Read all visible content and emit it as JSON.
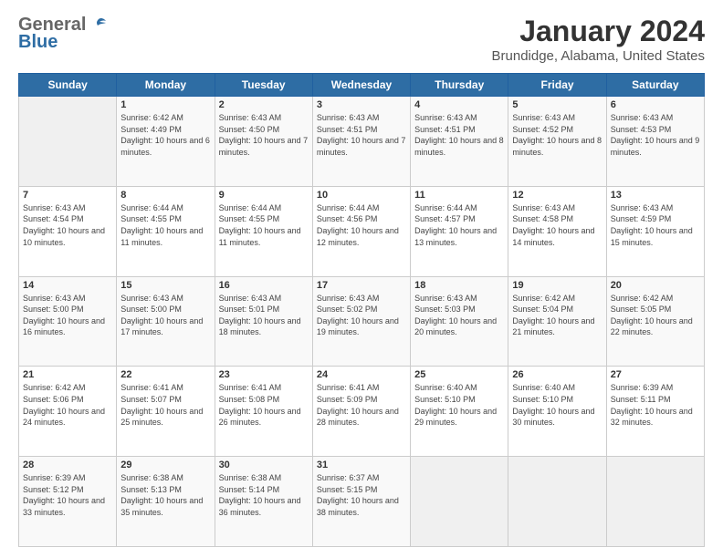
{
  "header": {
    "logo_general": "General",
    "logo_blue": "Blue",
    "title": "January 2024",
    "subtitle": "Brundidge, Alabama, United States"
  },
  "calendar": {
    "days_of_week": [
      "Sunday",
      "Monday",
      "Tuesday",
      "Wednesday",
      "Thursday",
      "Friday",
      "Saturday"
    ],
    "weeks": [
      [
        {
          "day": "",
          "sunrise": "",
          "sunset": "",
          "daylight": "",
          "empty": true
        },
        {
          "day": "1",
          "sunrise": "Sunrise: 6:42 AM",
          "sunset": "Sunset: 4:49 PM",
          "daylight": "Daylight: 10 hours and 6 minutes."
        },
        {
          "day": "2",
          "sunrise": "Sunrise: 6:43 AM",
          "sunset": "Sunset: 4:50 PM",
          "daylight": "Daylight: 10 hours and 7 minutes."
        },
        {
          "day": "3",
          "sunrise": "Sunrise: 6:43 AM",
          "sunset": "Sunset: 4:51 PM",
          "daylight": "Daylight: 10 hours and 7 minutes."
        },
        {
          "day": "4",
          "sunrise": "Sunrise: 6:43 AM",
          "sunset": "Sunset: 4:51 PM",
          "daylight": "Daylight: 10 hours and 8 minutes."
        },
        {
          "day": "5",
          "sunrise": "Sunrise: 6:43 AM",
          "sunset": "Sunset: 4:52 PM",
          "daylight": "Daylight: 10 hours and 8 minutes."
        },
        {
          "day": "6",
          "sunrise": "Sunrise: 6:43 AM",
          "sunset": "Sunset: 4:53 PM",
          "daylight": "Daylight: 10 hours and 9 minutes."
        }
      ],
      [
        {
          "day": "7",
          "sunrise": "Sunrise: 6:43 AM",
          "sunset": "Sunset: 4:54 PM",
          "daylight": "Daylight: 10 hours and 10 minutes."
        },
        {
          "day": "8",
          "sunrise": "Sunrise: 6:44 AM",
          "sunset": "Sunset: 4:55 PM",
          "daylight": "Daylight: 10 hours and 11 minutes."
        },
        {
          "day": "9",
          "sunrise": "Sunrise: 6:44 AM",
          "sunset": "Sunset: 4:55 PM",
          "daylight": "Daylight: 10 hours and 11 minutes."
        },
        {
          "day": "10",
          "sunrise": "Sunrise: 6:44 AM",
          "sunset": "Sunset: 4:56 PM",
          "daylight": "Daylight: 10 hours and 12 minutes."
        },
        {
          "day": "11",
          "sunrise": "Sunrise: 6:44 AM",
          "sunset": "Sunset: 4:57 PM",
          "daylight": "Daylight: 10 hours and 13 minutes."
        },
        {
          "day": "12",
          "sunrise": "Sunrise: 6:43 AM",
          "sunset": "Sunset: 4:58 PM",
          "daylight": "Daylight: 10 hours and 14 minutes."
        },
        {
          "day": "13",
          "sunrise": "Sunrise: 6:43 AM",
          "sunset": "Sunset: 4:59 PM",
          "daylight": "Daylight: 10 hours and 15 minutes."
        }
      ],
      [
        {
          "day": "14",
          "sunrise": "Sunrise: 6:43 AM",
          "sunset": "Sunset: 5:00 PM",
          "daylight": "Daylight: 10 hours and 16 minutes."
        },
        {
          "day": "15",
          "sunrise": "Sunrise: 6:43 AM",
          "sunset": "Sunset: 5:00 PM",
          "daylight": "Daylight: 10 hours and 17 minutes."
        },
        {
          "day": "16",
          "sunrise": "Sunrise: 6:43 AM",
          "sunset": "Sunset: 5:01 PM",
          "daylight": "Daylight: 10 hours and 18 minutes."
        },
        {
          "day": "17",
          "sunrise": "Sunrise: 6:43 AM",
          "sunset": "Sunset: 5:02 PM",
          "daylight": "Daylight: 10 hours and 19 minutes."
        },
        {
          "day": "18",
          "sunrise": "Sunrise: 6:43 AM",
          "sunset": "Sunset: 5:03 PM",
          "daylight": "Daylight: 10 hours and 20 minutes."
        },
        {
          "day": "19",
          "sunrise": "Sunrise: 6:42 AM",
          "sunset": "Sunset: 5:04 PM",
          "daylight": "Daylight: 10 hours and 21 minutes."
        },
        {
          "day": "20",
          "sunrise": "Sunrise: 6:42 AM",
          "sunset": "Sunset: 5:05 PM",
          "daylight": "Daylight: 10 hours and 22 minutes."
        }
      ],
      [
        {
          "day": "21",
          "sunrise": "Sunrise: 6:42 AM",
          "sunset": "Sunset: 5:06 PM",
          "daylight": "Daylight: 10 hours and 24 minutes."
        },
        {
          "day": "22",
          "sunrise": "Sunrise: 6:41 AM",
          "sunset": "Sunset: 5:07 PM",
          "daylight": "Daylight: 10 hours and 25 minutes."
        },
        {
          "day": "23",
          "sunrise": "Sunrise: 6:41 AM",
          "sunset": "Sunset: 5:08 PM",
          "daylight": "Daylight: 10 hours and 26 minutes."
        },
        {
          "day": "24",
          "sunrise": "Sunrise: 6:41 AM",
          "sunset": "Sunset: 5:09 PM",
          "daylight": "Daylight: 10 hours and 28 minutes."
        },
        {
          "day": "25",
          "sunrise": "Sunrise: 6:40 AM",
          "sunset": "Sunset: 5:10 PM",
          "daylight": "Daylight: 10 hours and 29 minutes."
        },
        {
          "day": "26",
          "sunrise": "Sunrise: 6:40 AM",
          "sunset": "Sunset: 5:10 PM",
          "daylight": "Daylight: 10 hours and 30 minutes."
        },
        {
          "day": "27",
          "sunrise": "Sunrise: 6:39 AM",
          "sunset": "Sunset: 5:11 PM",
          "daylight": "Daylight: 10 hours and 32 minutes."
        }
      ],
      [
        {
          "day": "28",
          "sunrise": "Sunrise: 6:39 AM",
          "sunset": "Sunset: 5:12 PM",
          "daylight": "Daylight: 10 hours and 33 minutes."
        },
        {
          "day": "29",
          "sunrise": "Sunrise: 6:38 AM",
          "sunset": "Sunset: 5:13 PM",
          "daylight": "Daylight: 10 hours and 35 minutes."
        },
        {
          "day": "30",
          "sunrise": "Sunrise: 6:38 AM",
          "sunset": "Sunset: 5:14 PM",
          "daylight": "Daylight: 10 hours and 36 minutes."
        },
        {
          "day": "31",
          "sunrise": "Sunrise: 6:37 AM",
          "sunset": "Sunset: 5:15 PM",
          "daylight": "Daylight: 10 hours and 38 minutes."
        },
        {
          "day": "",
          "sunrise": "",
          "sunset": "",
          "daylight": "",
          "empty": true
        },
        {
          "day": "",
          "sunrise": "",
          "sunset": "",
          "daylight": "",
          "empty": true
        },
        {
          "day": "",
          "sunrise": "",
          "sunset": "",
          "daylight": "",
          "empty": true
        }
      ]
    ]
  }
}
